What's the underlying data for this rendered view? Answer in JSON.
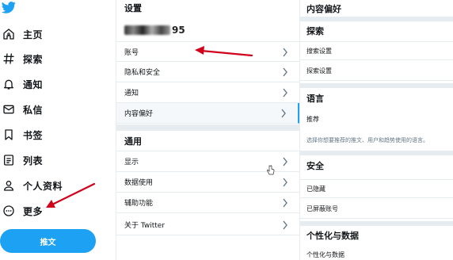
{
  "nav": {
    "items": [
      {
        "label": "主页",
        "icon": "home-icon"
      },
      {
        "label": "探索",
        "icon": "hashtag-icon"
      },
      {
        "label": "通知",
        "icon": "bell-icon"
      },
      {
        "label": "私信",
        "icon": "mail-icon"
      },
      {
        "label": "书签",
        "icon": "bookmark-icon"
      },
      {
        "label": "列表",
        "icon": "list-icon"
      },
      {
        "label": "个人资料",
        "icon": "person-icon"
      },
      {
        "label": "更多",
        "icon": "more-icon"
      }
    ],
    "tweet_label": "推文"
  },
  "settings": {
    "title": "设置",
    "account_suffix": "95",
    "rows": [
      "账号",
      "隐私和安全",
      "通知",
      "内容偏好"
    ],
    "general_title": "通用",
    "general_rows": [
      "显示",
      "数据使用",
      "辅助功能",
      "关于 Twitter"
    ]
  },
  "prefs": {
    "title": "内容偏好",
    "explore_title": "探索",
    "explore_rows": [
      "搜索设置",
      "探索设置"
    ],
    "language_title": "语言",
    "language_row": "推荐",
    "language_desc": "选择你想要推荐的推文、用户和趋势使用的语言。",
    "safety_title": "安全",
    "safety_rows": [
      "已隐藏",
      "已屏蔽账号"
    ],
    "personal_title": "个性化与数据",
    "personal_row": "个性化与数据"
  },
  "colors": {
    "brand": "#1da1f2",
    "divider": "#e6ecf0",
    "annotation": "#d0021b"
  }
}
